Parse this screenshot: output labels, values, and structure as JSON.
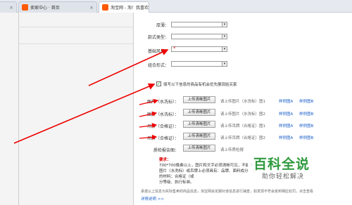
{
  "tabs": [
    {
      "label": "卖家中心 · 首页",
      "fav_text": "淘",
      "fav_color": "#ff5a00"
    },
    {
      "label": "淘宝网 - 淘！我喜欢",
      "fav_text": "淘",
      "fav_color": "#ff5a00"
    }
  ],
  "form": {
    "fields": [
      {
        "label": "厚薄："
      },
      {
        "label": "款式类型："
      },
      {
        "label": "基础风格：",
        "required": "*"
      },
      {
        "label": "组合形式："
      }
    ],
    "checkbox_label": "填写以下信息的商品有机会优先展现给买家",
    "rows": [
      {
        "label": "图片（水洗标）：",
        "button": "上传清晰图片",
        "hint": "请上传图片（水洗标）图1",
        "link1": "样例图A",
        "link2": "样例图B"
      },
      {
        "label": "图片（水洗标）：",
        "button": "上传清晰图片",
        "hint": "请上传图片（水洗标）图2",
        "link1": "样例图A",
        "link2": "样例图B"
      },
      {
        "label": "吊牌（合格证）：",
        "button": "上传清晰图片",
        "hint": "请上传吊牌（合格证）图1",
        "link1": "样例图A",
        "link2": "样例图B"
      },
      {
        "label": "吊牌（合格证）：",
        "button": "上传清晰图片",
        "hint": "请上传吊牌（合格证）图2",
        "link1": "样例图A",
        "link2": "样例图B"
      },
      {
        "label": "质检报告图：",
        "button": "上传清晰图片",
        "hint": "请上传质检报",
        "link1": "",
        "link2": ""
      }
    ],
    "requirements_title": "要求：",
    "requirements_lines": [
      "700*700像素以上，图片和文字必须清晰可见，不能模糊；",
      "图片（水洗标）或吊牌上必须具有：品牌、面料成分、洗",
      "的材料；合格证（或",
      "分等级、执行标准。"
    ],
    "footer_text": "承诺以上信息为实际售卖的商品信息，淘宝网会定期对该信息进行抽查，如发现不符会受到相应处罚，点击查看",
    "footer_link": "详情说明 >>"
  },
  "watermark": {
    "title": "百科全说",
    "subtitle": "助你轻松解决"
  }
}
